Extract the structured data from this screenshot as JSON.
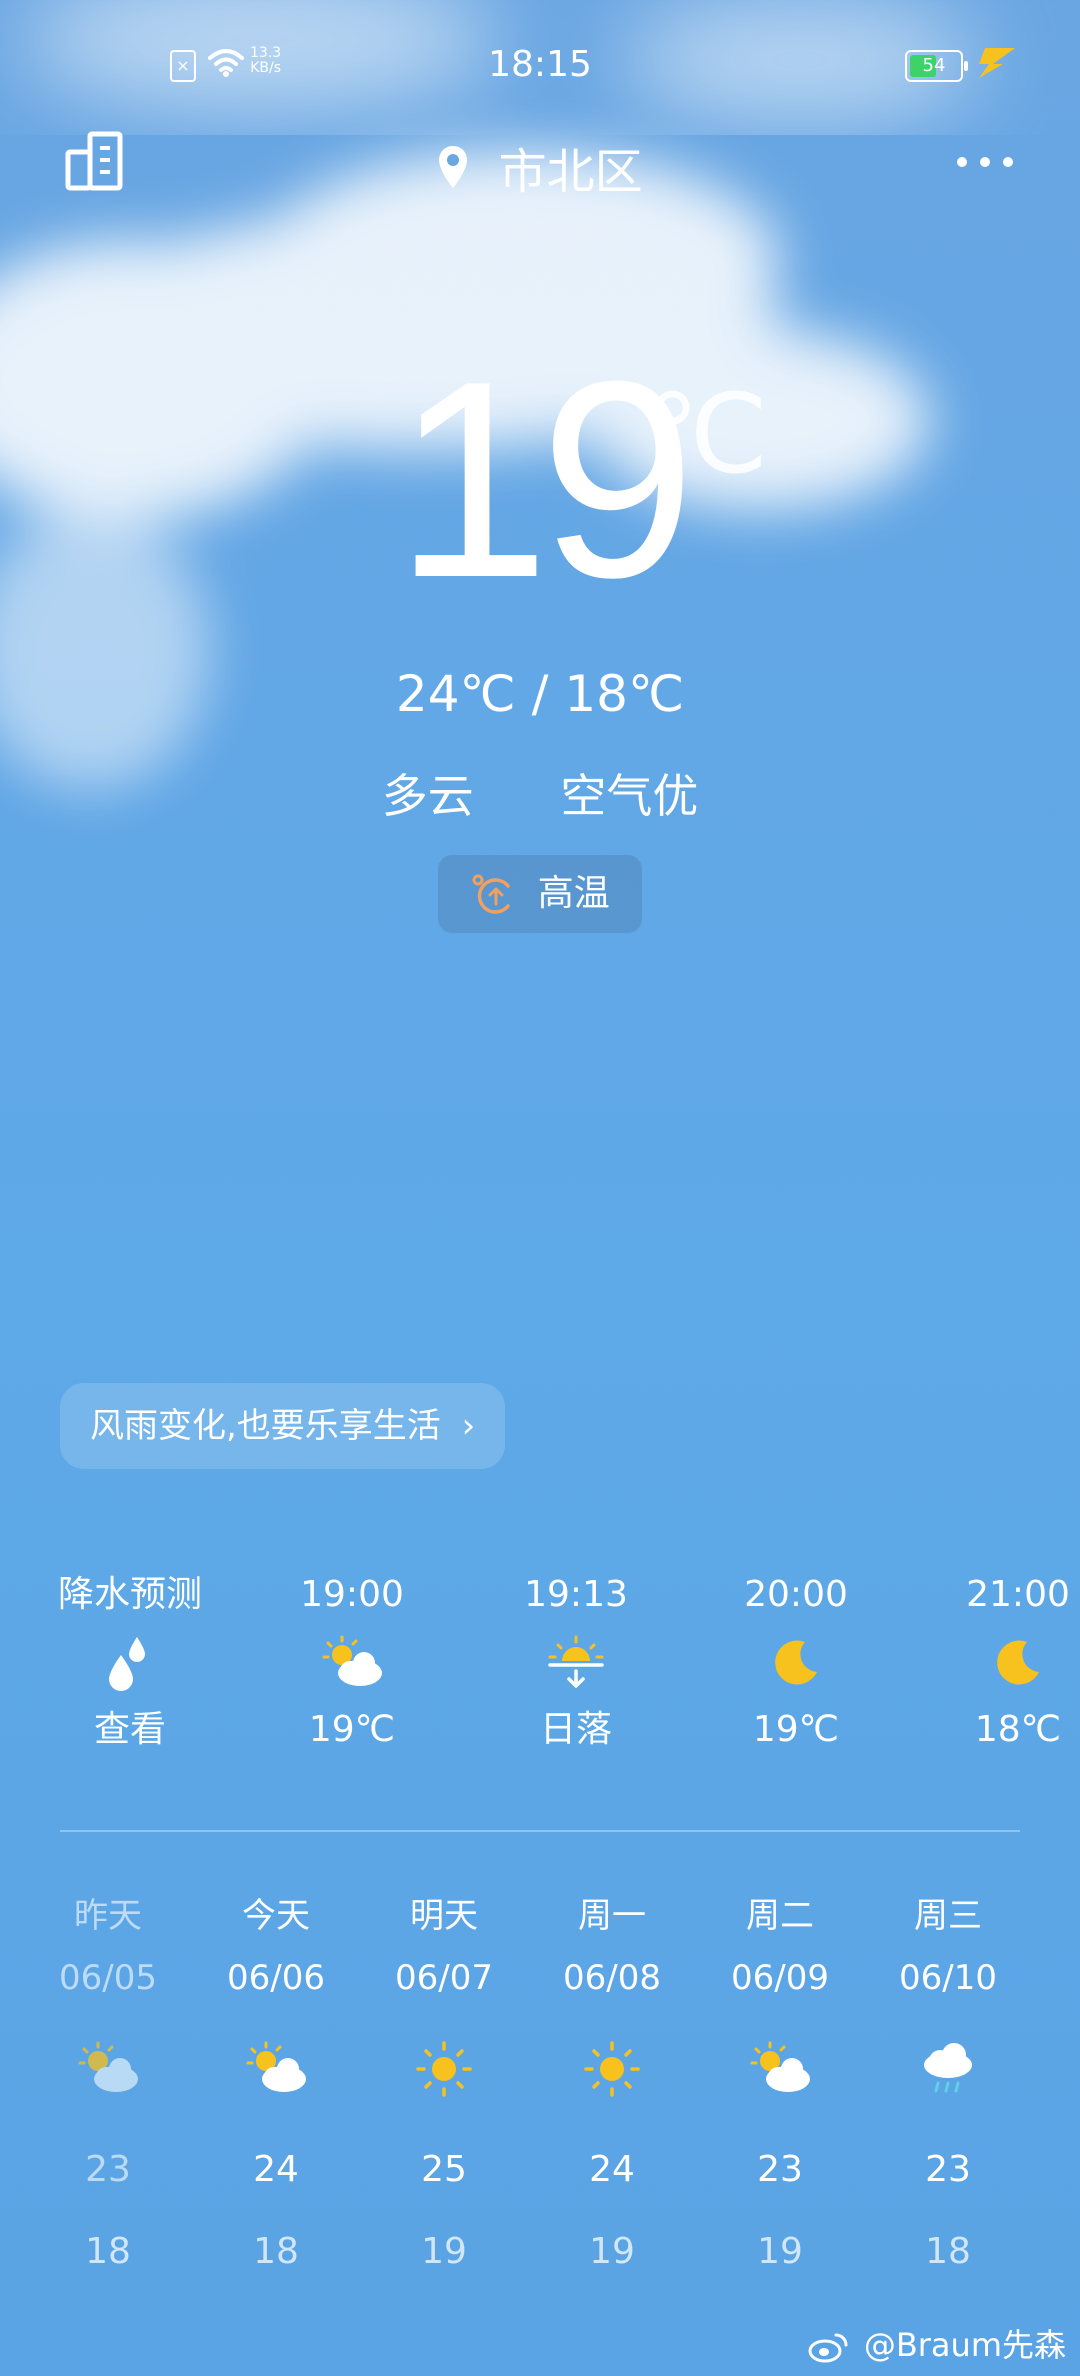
{
  "status_bar": {
    "time": "18:15",
    "net_speed": "13.3",
    "net_speed_unit": "KB/s",
    "battery_level": "54",
    "battery_color": "#3ed26a"
  },
  "header": {
    "location": "市北区",
    "icons": [
      "city-manage-icon",
      "location-pin-icon",
      "more-icon"
    ]
  },
  "current": {
    "temperature": "19",
    "unit": "℃",
    "range": "24℃  /  18℃",
    "condition": "多云",
    "air_quality": "空气优",
    "alert": "高温"
  },
  "tip": "风雨变化,也要乐享生活",
  "hourly": [
    {
      "top": "降水预测",
      "icon": "raindrops-icon",
      "bottom": "查看"
    },
    {
      "top": "19:00",
      "icon": "partly-cloudy-icon",
      "bottom": "19℃"
    },
    {
      "top": "19:13",
      "icon": "sunset-icon",
      "bottom": "日落"
    },
    {
      "top": "20:00",
      "icon": "moon-icon",
      "bottom": "19℃"
    },
    {
      "top": "21:00",
      "icon": "moon-icon",
      "bottom": "18℃"
    }
  ],
  "daily": [
    {
      "day": "昨天",
      "date": "06/05",
      "icon": "partly-cloudy-icon",
      "high": "23",
      "low": "18"
    },
    {
      "day": "今天",
      "date": "06/06",
      "icon": "partly-cloudy-icon",
      "high": "24",
      "low": "18"
    },
    {
      "day": "明天",
      "date": "06/07",
      "icon": "sun-icon",
      "high": "25",
      "low": "19"
    },
    {
      "day": "周一",
      "date": "06/08",
      "icon": "sun-icon",
      "high": "24",
      "low": "19"
    },
    {
      "day": "周二",
      "date": "06/09",
      "icon": "partly-cloudy-icon",
      "high": "23",
      "low": "19"
    },
    {
      "day": "周三",
      "date": "06/10",
      "icon": "rain-cloud-icon",
      "high": "23",
      "low": "18"
    }
  ],
  "watermark": "@Braum先森",
  "colors": {
    "sun": "#f7c11e",
    "accent_orange": "#f0a060"
  }
}
